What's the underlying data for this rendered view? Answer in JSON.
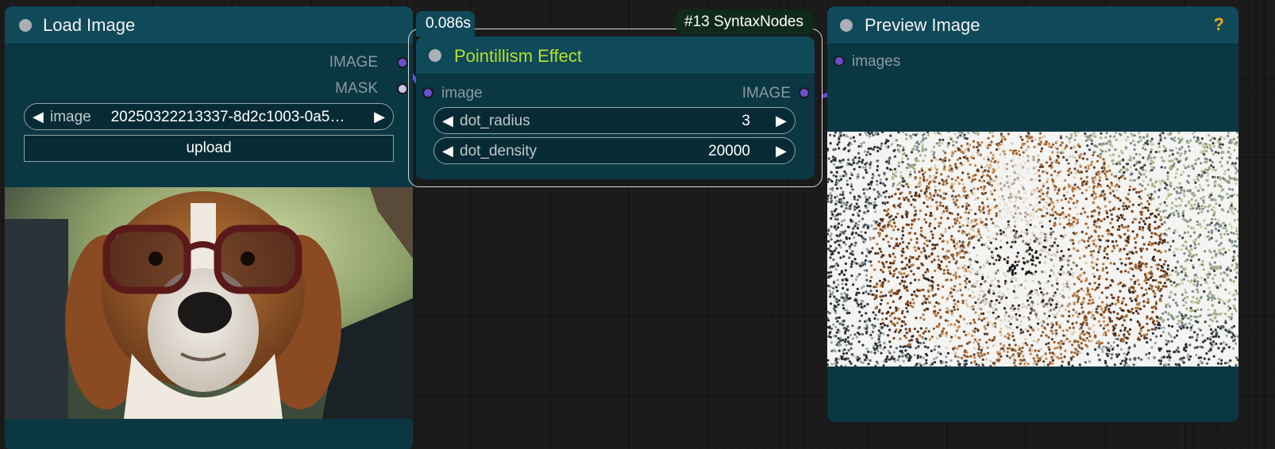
{
  "colors": {
    "node_body": "#0b3743",
    "node_header": "#10495a",
    "image_slot": "#6a4fd0",
    "mask_slot": "#c8c4e6",
    "title_highlight": "#b8e02a",
    "help": "#f0a818"
  },
  "load_image": {
    "title": "Load Image",
    "outputs": [
      "IMAGE",
      "MASK"
    ],
    "image_widget": {
      "name": "image",
      "value": "20250322213337-8d2c1003-0a5…"
    },
    "upload_label": "upload",
    "preview_subject": "beagle wearing glasses"
  },
  "pointillism": {
    "time_badge": "0.086s",
    "id_badge": "#13 SyntaxNodes",
    "title": "Pointillism Effect",
    "input": "image",
    "output": "IMAGE",
    "widgets": [
      {
        "name": "dot_radius",
        "value": "3"
      },
      {
        "name": "dot_density",
        "value": "20000"
      }
    ]
  },
  "preview_image": {
    "title": "Preview Image",
    "input": "images",
    "help": "?",
    "preview_subject": "pointillism render of beagle"
  }
}
